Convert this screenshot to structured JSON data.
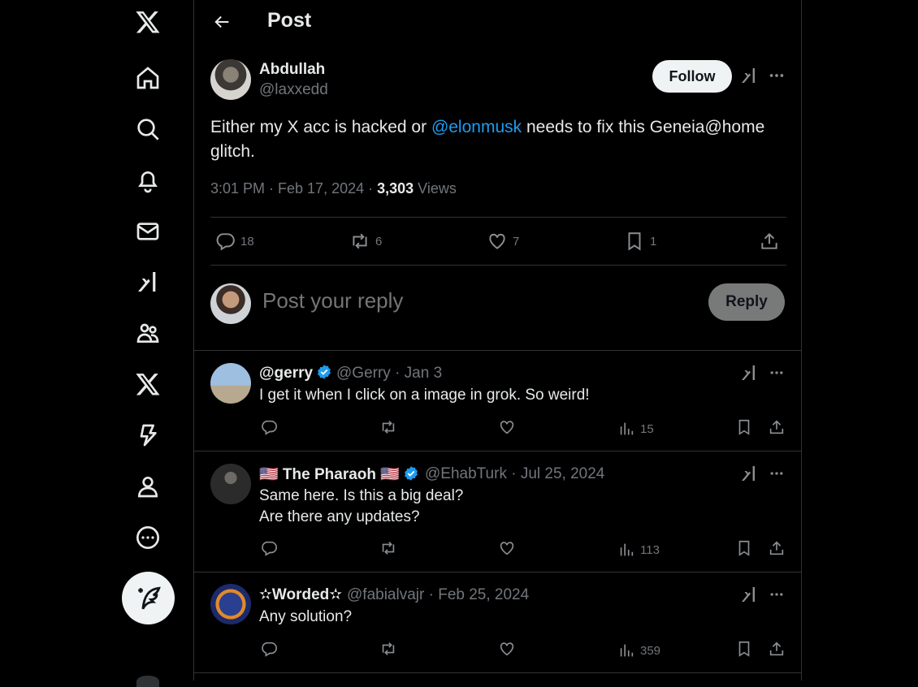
{
  "nav": {
    "items": [
      {
        "name": "x-logo-icon"
      },
      {
        "name": "home-icon"
      },
      {
        "name": "search-icon"
      },
      {
        "name": "notifications-icon"
      },
      {
        "name": "messages-icon"
      },
      {
        "name": "grok-icon"
      },
      {
        "name": "communities-icon"
      },
      {
        "name": "premium-icon"
      },
      {
        "name": "verified-orgs-icon"
      },
      {
        "name": "profile-icon"
      },
      {
        "name": "more-icon"
      }
    ],
    "compose_icon": "compose-feather-icon"
  },
  "header": {
    "title": "Post"
  },
  "post": {
    "author_name": "Abdullah",
    "author_handle": "@laxxedd",
    "follow_label": "Follow",
    "text_before": "Either my X acc is hacked or ",
    "mention": "@elonmusk",
    "text_after": " needs to fix this Geneia@home glitch.",
    "time": "3:01 PM · Feb 17, 2024 · ",
    "views_count": "3,303",
    "views_label": " Views",
    "stats": {
      "replies": "18",
      "reposts": "6",
      "likes": "7",
      "bookmarks": "1"
    }
  },
  "compose_reply": {
    "placeholder": "Post your reply",
    "button_label": "Reply"
  },
  "replies": [
    {
      "name": "@gerry",
      "handle_date": "@Gerry · Jan 3",
      "text": "I get it when I click on a image in grok. So weird!",
      "views": "15",
      "verified": true
    },
    {
      "name": "🇺🇸 The Pharaoh 🇺🇸",
      "handle_date": "@EhabTurk · Jul 25, 2024",
      "text_line1": "Same here. Is this a big deal?",
      "text_line2": "Are there any updates?",
      "views": "113",
      "verified": true
    },
    {
      "name": "✫Worded✫",
      "handle_date": "@fabialvajr · Feb 25, 2024",
      "text": "Any solution?",
      "views": "359",
      "verified": false
    }
  ],
  "colors": {
    "background": "#000000",
    "text": "#e7e9ea",
    "muted": "#71767b",
    "link": "#1d9bf0",
    "verified": "#1d9bf0",
    "border": "#2f3336"
  }
}
